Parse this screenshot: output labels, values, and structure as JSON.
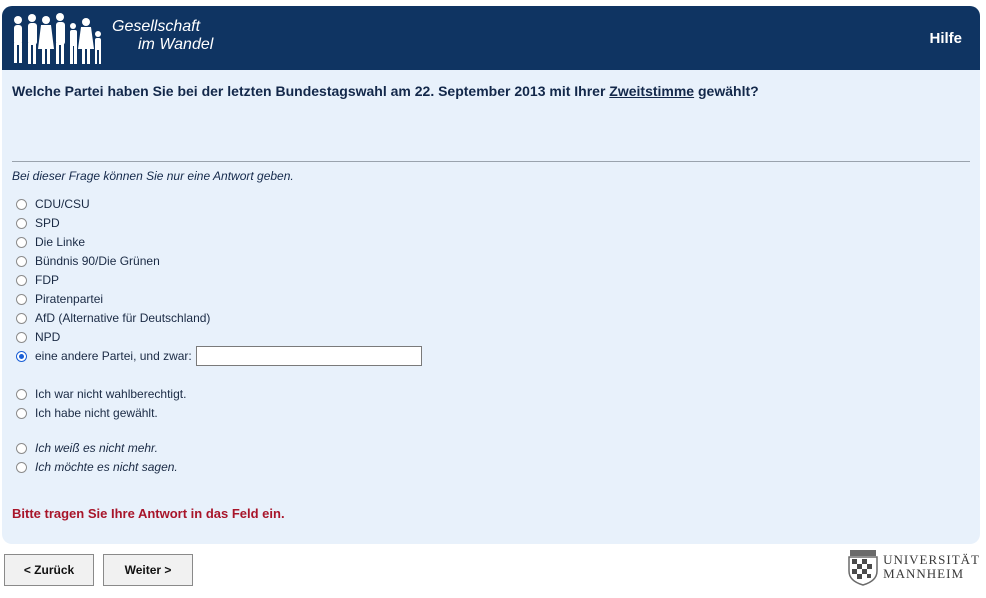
{
  "header": {
    "logo_line1": "Gesellschaft",
    "logo_line2": "im Wandel",
    "help_label": "Hilfe"
  },
  "question": {
    "text_before": "Welche Partei haben Sie bei der letzten Bundestagswahl am 22. September 2013 mit Ihrer ",
    "link_text": "Zweitstimme",
    "text_after": " gewählt?"
  },
  "instruction": "Bei dieser Frage können Sie nur eine Antwort geben.",
  "options": [
    {
      "label": "CDU/CSU",
      "selected": false
    },
    {
      "label": "SPD",
      "selected": false
    },
    {
      "label": "Die Linke",
      "selected": false
    },
    {
      "label": "Bündnis 90/Die Grünen",
      "selected": false
    },
    {
      "label": "FDP",
      "selected": false
    },
    {
      "label": "Piratenpartei",
      "selected": false
    },
    {
      "label": "AfD (Alternative für Deutschland)",
      "selected": false
    },
    {
      "label": "NPD",
      "selected": false
    },
    {
      "label": "eine andere Partei, und zwar:",
      "selected": true,
      "input_value": ""
    },
    {
      "label": "Ich war nicht wahlberechtigt.",
      "selected": false
    },
    {
      "label": "Ich habe nicht gewählt.",
      "selected": false
    },
    {
      "label": "Ich weiß es nicht mehr.",
      "selected": false
    },
    {
      "label": "Ich möchte es nicht sagen.",
      "selected": false
    }
  ],
  "error_message": "Bitte tragen Sie Ihre Antwort in das Feld ein.",
  "nav": {
    "back_label": "< Zurück",
    "next_label": "Weiter >"
  },
  "university": {
    "line1": "UNIVERSITÄT",
    "line2": "MANNHEIM"
  },
  "colors": {
    "header": "#0f3462",
    "panel": "#e8f1fb",
    "error": "#a8152a",
    "selected_radio": "#1a5fd6"
  }
}
